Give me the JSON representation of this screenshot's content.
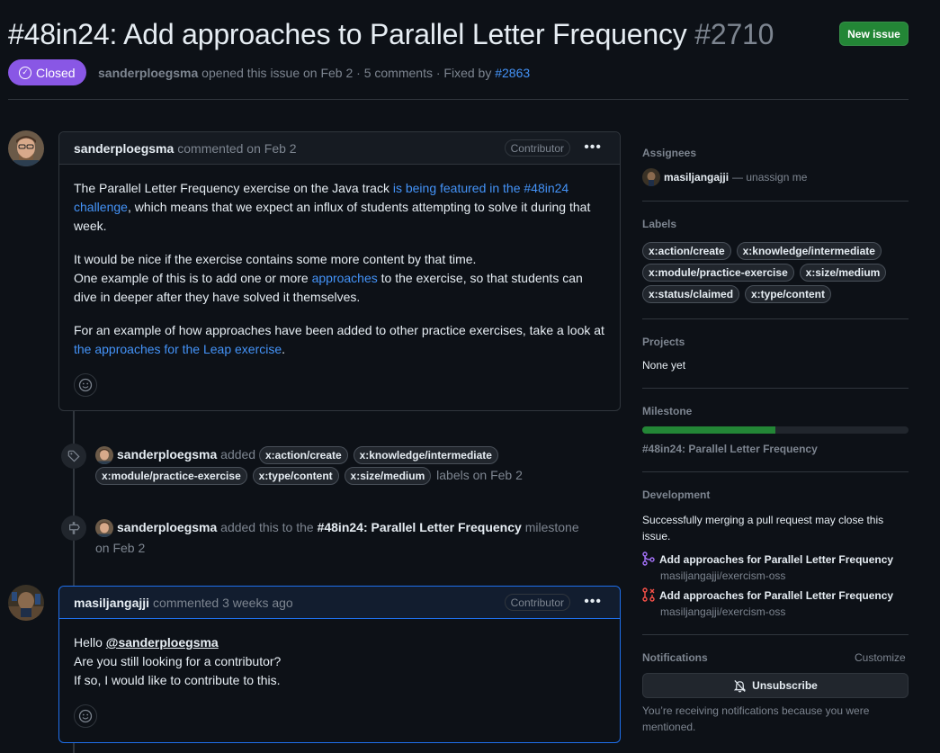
{
  "issue": {
    "title": "#48in24: Add approaches to Parallel Letter Frequency",
    "number": "#2710",
    "state": "Closed",
    "author": "sanderploegsma",
    "meta_middle": "opened this issue on Feb 2 · 5 comments · Fixed by",
    "fixed_by": "#2863",
    "new_issue_label": "New issue"
  },
  "comments": [
    {
      "author": "sanderploegsma",
      "when": "commented on Feb 2",
      "badge": "Contributor",
      "p1_pre": "The Parallel Letter Frequency exercise on the Java track ",
      "p1_link": "is being featured in the #48in24 challenge",
      "p1_post": ", which means that we expect an influx of students attempting to solve it during that week.",
      "p2_line1": "It would be nice if the exercise contains some more content by that time.",
      "p2_pre": "One example of this is to add one or more ",
      "p2_link": "approaches",
      "p2_post": " to the exercise, so that students can dive in deeper after they have solved it themselves.",
      "p3_pre": "For an example of how approaches have been added to other practice exercises, take a look at ",
      "p3_link": "the approaches for the Leap exercise",
      "p3_post": "."
    },
    {
      "author": "masiljangajji",
      "when": "commented 3 weeks ago",
      "badge": "Contributor",
      "line1_pre": "Hello ",
      "mention": "@sanderploegsma",
      "line2": "Are you still looking for a contributor?",
      "line3": "If so, I would like to contribute to this."
    }
  ],
  "events": {
    "labels_event": {
      "actor": "sanderploegsma",
      "verb": "added",
      "labels": [
        "x:action/create",
        "x:knowledge/intermediate",
        "x:module/practice-exercise",
        "x:type/content",
        "x:size/medium"
      ],
      "suffix": "labels on Feb 2"
    },
    "milestone_event": {
      "actor": "sanderploegsma",
      "verb": "added this to the",
      "milestone": "#48in24: Parallel Letter Frequency",
      "suffix_a": "milestone",
      "suffix_b": "on Feb 2"
    }
  },
  "sidebar": {
    "assignees": {
      "heading": "Assignees",
      "name": "masiljangajji",
      "action": "— unassign me"
    },
    "labels": {
      "heading": "Labels",
      "items": [
        "x:action/create",
        "x:knowledge/intermediate",
        "x:module/practice-exercise",
        "x:size/medium",
        "x:status/claimed",
        "x:type/content"
      ]
    },
    "projects": {
      "heading": "Projects",
      "value": "None yet"
    },
    "milestone": {
      "heading": "Milestone",
      "name": "#48in24: Parallel Letter Frequency",
      "progress_percent": 50
    },
    "development": {
      "heading": "Development",
      "note": "Successfully merging a pull request may close this issue.",
      "prs": [
        {
          "title": "Add approaches for Parallel Letter Frequency",
          "repo": "masiljangajji/exercism-oss",
          "status": "merged"
        },
        {
          "title": "Add approaches for Parallel Letter Frequency",
          "repo": "masiljangajji/exercism-oss",
          "status": "closed"
        }
      ]
    },
    "notifications": {
      "heading": "Notifications",
      "customize": "Customize",
      "button": "Unsubscribe",
      "note": "You’re receiving notifications because you were mentioned."
    }
  },
  "colors": {
    "closed": "#8957e5",
    "new_issue": "#238636",
    "link": "#4493f8",
    "merged_icon": "#a371f7",
    "closed_pr_icon": "#f85149"
  }
}
